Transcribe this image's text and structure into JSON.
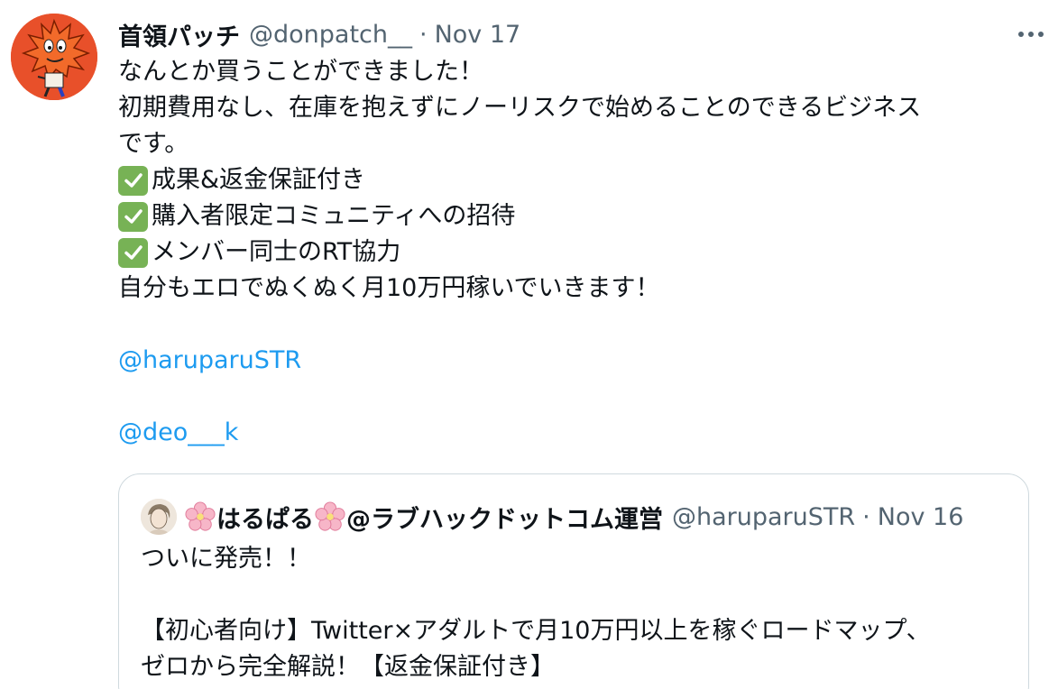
{
  "tweet": {
    "display_name": "首領パッチ",
    "handle": "@donpatch__",
    "separator": "·",
    "date": "Nov 17",
    "more_icon": "more-horizontal-icon",
    "lines": {
      "l1": "なんとか買うことができました！",
      "l2": "初期費用なし、在庫を抱えずにノーリスクで始めることのできるビジネス",
      "l3": "です。",
      "l4": "成果&返金保証付き",
      "l5": "購入者限定コミュニティへの招待",
      "l6": "メンバー同士のRT協力",
      "l7": "自分もエロでぬくぬく月10万円稼いでいきます！"
    },
    "check_icon": "check-mark-button-icon",
    "mentions": [
      "@haruparuSTR",
      "@deo___k"
    ]
  },
  "quote": {
    "name_part1": "はるぱる",
    "name_part2": "@ラブハックドットコム運営",
    "flower_icon": "cherry-blossom-icon",
    "handle": "@haruparuSTR",
    "separator": "·",
    "date": "Nov 16",
    "lines": {
      "l1": "ついに発売！！",
      "l2": "【初心者向け】Twitter×アダルトで月10万円以上を稼ぐロードマップ、",
      "l3": "ゼロから完全解説！【返金保証付き】"
    }
  },
  "colors": {
    "link": "#1d9bf0",
    "secondary_text": "#536471",
    "primary_text": "#0f1419",
    "check_green": "#77b255",
    "border": "#cfd9de"
  }
}
